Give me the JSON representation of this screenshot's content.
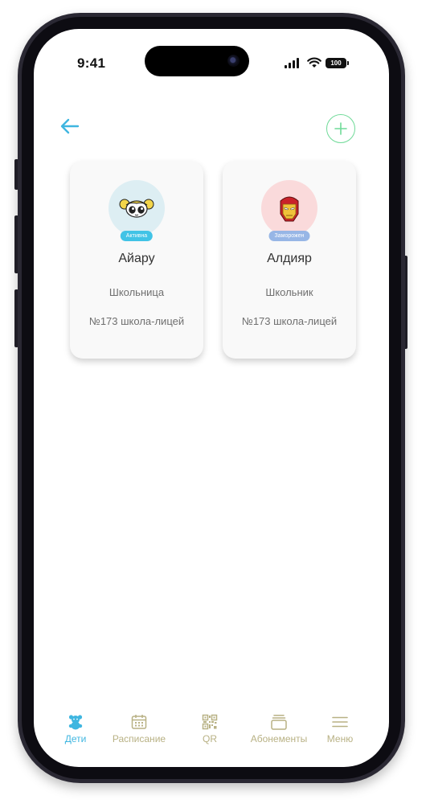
{
  "status_bar": {
    "time": "9:41",
    "battery": "100"
  },
  "colors": {
    "accent": "#3fb6e0",
    "add_green": "#6fda98",
    "badge_active": "#41c3e6",
    "badge_frozen": "#97b6e6",
    "nav_inactive": "#b8b184",
    "avatar1_bg": "#ddeef3",
    "avatar2_bg": "#fadadb"
  },
  "header": {
    "back_icon": "arrow-left-icon",
    "add_icon": "plus-icon"
  },
  "children": [
    {
      "name": "Айару",
      "status": "Активна",
      "role": "Школьница",
      "school": "№173 школа-лицей",
      "avatar": "powerpuff-girl-avatar"
    },
    {
      "name": "Алдияр",
      "status": "Заморожен",
      "role": "Школьник",
      "school": "№173 школа-лицей",
      "avatar": "iron-man-avatar"
    }
  ],
  "nav": [
    {
      "label": "Дети",
      "icon": "teddy-bear-icon",
      "active": true
    },
    {
      "label": "Расписание",
      "icon": "calendar-icon",
      "active": false
    },
    {
      "label": "QR",
      "icon": "qr-code-icon",
      "active": false
    },
    {
      "label": "Абонементы",
      "icon": "cards-icon",
      "active": false
    },
    {
      "label": "Меню",
      "icon": "menu-icon",
      "active": false
    }
  ]
}
